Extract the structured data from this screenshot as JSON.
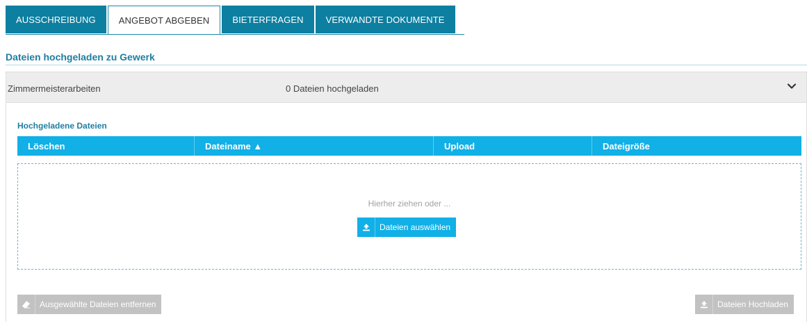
{
  "tabs": [
    {
      "label": "AUSSCHREIBUNG",
      "active": false
    },
    {
      "label": "ANGEBOT ABGEBEN",
      "active": true
    },
    {
      "label": "BIETERFRAGEN",
      "active": false
    },
    {
      "label": "VERWANDTE DOKUMENTE",
      "active": false
    }
  ],
  "section": {
    "title": "Dateien hochgeladen zu Gewerk"
  },
  "panel": {
    "trade": "Zimmermeisterarbeiten",
    "count": "0 Dateien hochgeladen",
    "files_title": "Hochgeladene Dateien"
  },
  "table": {
    "columns": [
      "Löschen",
      "Dateiname ▲",
      "Upload",
      "Dateigröße"
    ]
  },
  "dropzone": {
    "hint": "Hierher ziehen oder ...",
    "select_button": "Dateien auswählen"
  },
  "actions": {
    "remove_label": "Ausgewählte Dateien entfernen",
    "upload_label": "Dateien Hochladen"
  },
  "colors": {
    "tab_bg": "#0d7fa0",
    "accent": "#11b0e6",
    "heading": "#1e7ea1",
    "disabled": "#c2c2c2"
  },
  "icons": {
    "chevron": "chevron-down-icon",
    "upload": "upload-icon",
    "eraser": "eraser-icon"
  }
}
